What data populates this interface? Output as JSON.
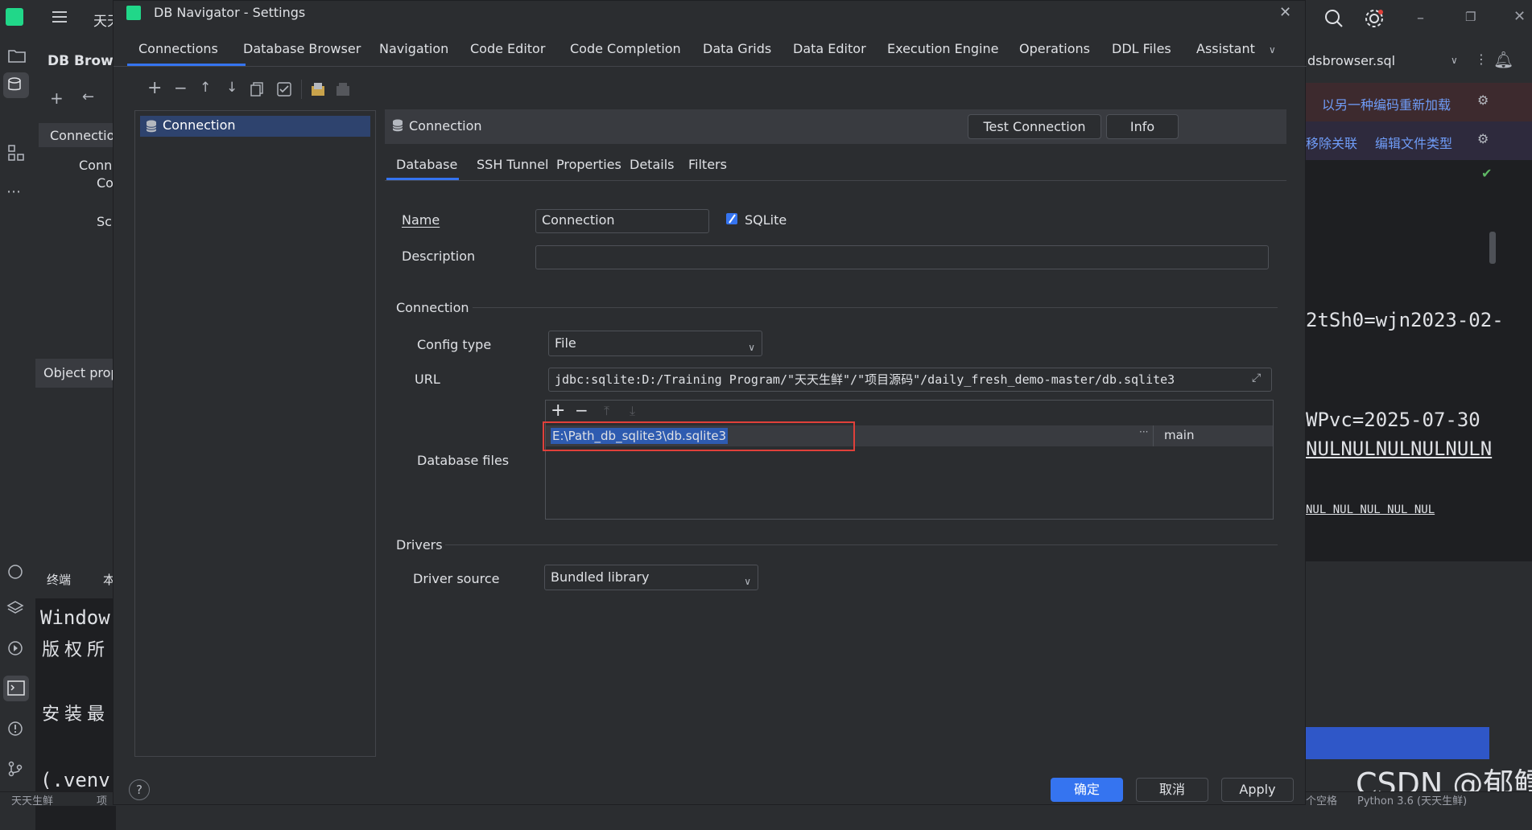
{
  "ide": {
    "top_title_fragment": "天天",
    "db_panel_title": "DB Brows",
    "conn_tab": "Connectio",
    "tree_items": [
      "Conn",
      "Co",
      "Sc"
    ],
    "object_props": "Object prop",
    "terminal_tab": "终端",
    "terminal_tab2": "本",
    "terminal_lines": [
      "Window",
      "版权所",
      "安装最",
      "(.venv"
    ],
    "editor_file_tab": "dsbrowser.sql",
    "reload_link": "以另一种编码重新加载",
    "remove_assoc_link": "移除关联",
    "edit_filetype_link": "编辑文件类型",
    "code_lines": [
      "2tSh0=wjn2023-02-",
      "WPvc=2025-07-30",
      "NULNULNULNULNULN",
      "NUL NUL NUL NUL NUL"
    ],
    "status_left": "天天生鲜",
    "status_left2": "项",
    "status_right1": "个空格",
    "status_right2": "Python 3.6 (天天生鲜)",
    "watermark": "CSDN @郁鳕"
  },
  "dialog": {
    "title": "DB Navigator - Settings",
    "tabs": [
      "Connections",
      "Database Browser",
      "Navigation",
      "Code Editor",
      "Code Completion",
      "Data Grids",
      "Data Editor",
      "Execution Engine",
      "Operations",
      "DDL Files",
      "Assistant"
    ],
    "tree_item": "Connection",
    "header_title": "Connection",
    "test_connection": "Test Connection",
    "info": "Info",
    "sub_tabs": [
      "Database",
      "SSH Tunnel",
      "Properties",
      "Details",
      "Filters"
    ],
    "name_label": "Name",
    "name_value": "Connection",
    "sqlite_label": "SQLite",
    "description_label": "Description",
    "description_value": "",
    "connection_section": "Connection",
    "config_type_label": "Config type",
    "config_type_value": "File",
    "url_label": "URL",
    "url_value": "jdbc:sqlite:D:/Training Program/\"天天生鲜\"/\"项目源码\"/daily_fresh_demo-master/db.sqlite3",
    "database_files_label": "Database files",
    "db_file_path": "E:\\Path_db_sqlite3\\db.sqlite3",
    "db_file_schema": "main",
    "drivers_section": "Drivers",
    "driver_source_label": "Driver source",
    "driver_source_value": "Bundled library",
    "ok_button": "确定",
    "cancel_button": "取消",
    "apply_button": "Apply",
    "help_glyph": "?"
  },
  "colors": {
    "accent": "#3574f0",
    "selection": "#2e436e",
    "highlight_box": "#e0403a",
    "link": "#6f9cf7"
  }
}
